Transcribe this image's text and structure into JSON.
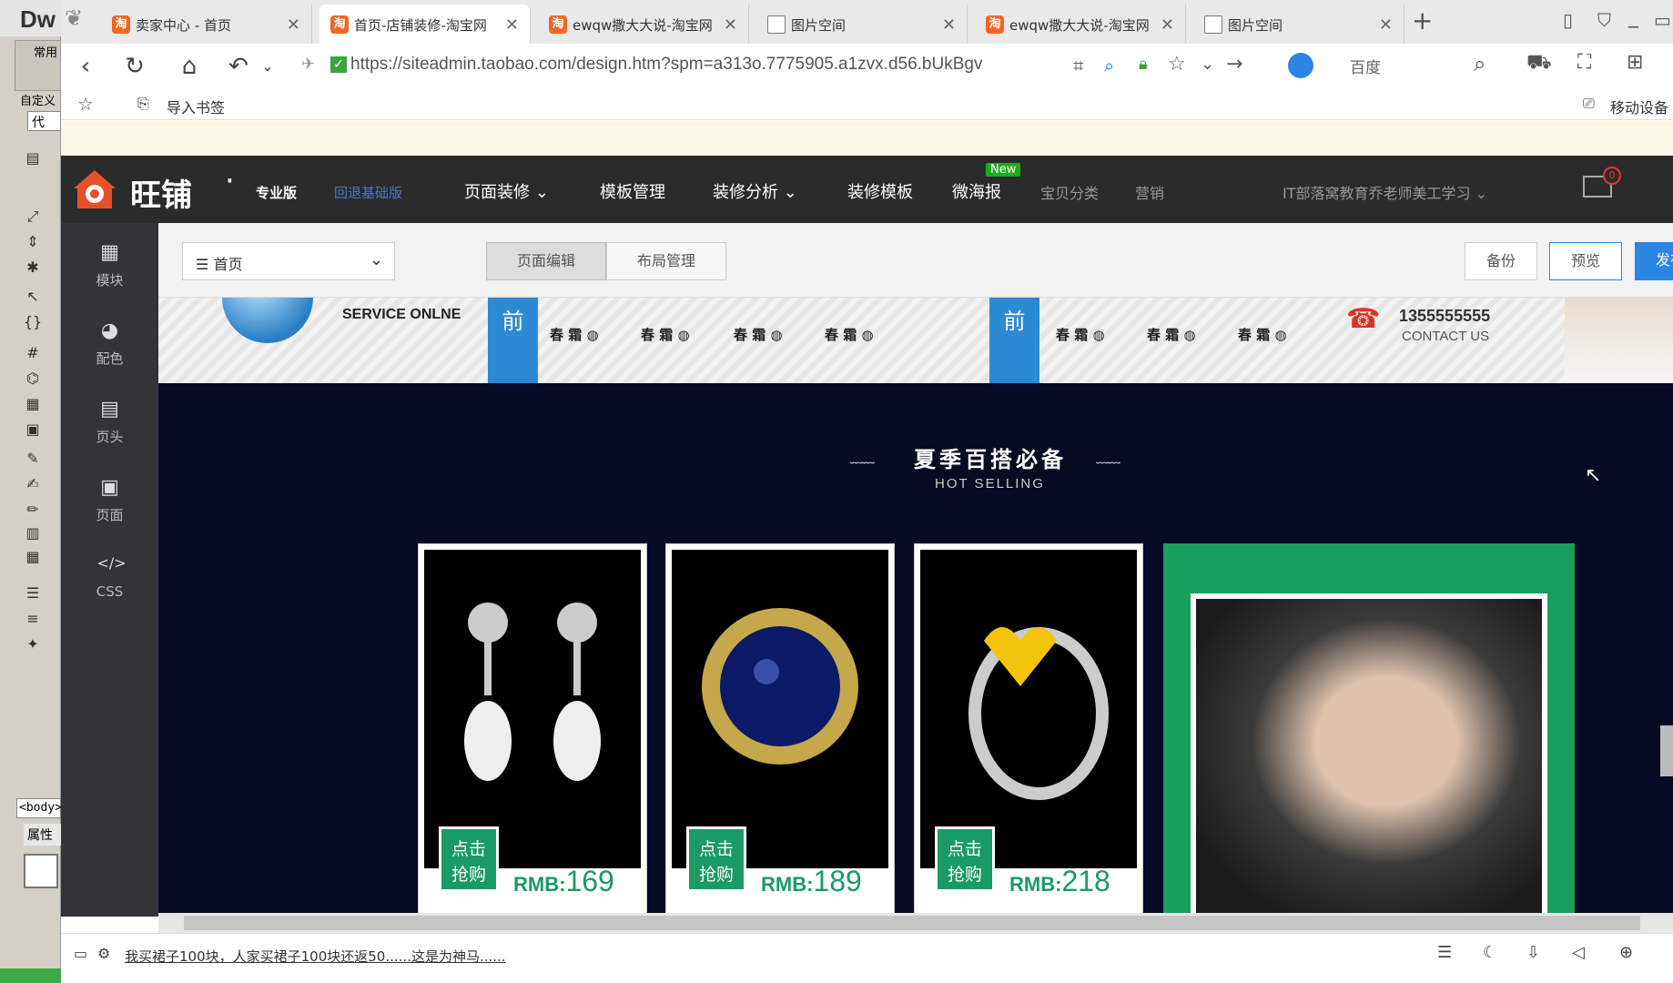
{
  "dreamweaver": {
    "logo": "Dw",
    "toolbar_labels": [
      "常用",
      "自定义",
      "代"
    ],
    "body_tag": "<body>",
    "properties_label": "属性"
  },
  "browser": {
    "tabs": [
      {
        "label": "卖家中心 - 首页",
        "icon": "taobao-icon",
        "active": false
      },
      {
        "label": "首页-店铺装修-淘宝网",
        "icon": "taobao-icon",
        "active": true
      },
      {
        "label": "ewqw撒大大说-淘宝网",
        "icon": "taobao-icon",
        "active": false
      },
      {
        "label": "图片空间",
        "icon": "doc-icon",
        "active": false
      },
      {
        "label": "ewqw撒大大说-淘宝网",
        "icon": "taobao-icon",
        "active": false
      },
      {
        "label": "图片空间",
        "icon": "doc-icon",
        "active": false
      }
    ],
    "url": "https://siteadmin.taobao.com/design.htm?spm=a313o.7775905.a1zvx.d56.bUkBgv",
    "search_engine": "百度",
    "bookmark_import": "导入书签",
    "mobile_bookmarks": "移动设备"
  },
  "wangpu": {
    "brand": "旺铺",
    "edition": "专业版",
    "back_basic": "回退基础版",
    "nav": [
      {
        "label": "页面装修",
        "dropdown": true
      },
      {
        "label": "模板管理",
        "dropdown": false
      },
      {
        "label": "装修分析",
        "dropdown": true
      },
      {
        "label": "装修模板",
        "dropdown": false
      },
      {
        "label": "微海报",
        "dropdown": false,
        "badge": "New"
      }
    ],
    "nav_secondary": [
      "宝贝分类",
      "营销"
    ],
    "account": "IT部落窝教育乔老师美工学习",
    "mail_count": "0",
    "sidebar": [
      {
        "label": "模块",
        "icon": "grid-icon"
      },
      {
        "label": "配色",
        "icon": "palette-icon"
      },
      {
        "label": "页头",
        "icon": "header-icon"
      },
      {
        "label": "页面",
        "icon": "page-icon"
      },
      {
        "label": "CSS",
        "icon": "code-icon"
      }
    ],
    "page_select": "首页",
    "tab_page_edit": "页面编辑",
    "tab_layout": "布局管理",
    "btn_backup": "备份",
    "btn_preview": "预览",
    "btn_publish": "发布站点"
  },
  "canvas": {
    "service_text": "SERVICE ONLNE",
    "service_tag": "前",
    "agents": [
      "春 霜",
      "春 霜",
      "春 霜",
      "春 霜",
      "春 霜",
      "春 霜",
      "春 霜"
    ],
    "phone": "1355555555",
    "contact": "CONTACT US",
    "section_title": "夏季百搭必备",
    "section_sub": "HOT SELLING",
    "products": [
      {
        "name": "pearl-earrings",
        "buy_label_1": "点击",
        "buy_label_2": "抢购",
        "currency": "RMB:",
        "price": "169"
      },
      {
        "name": "sapphire-ring",
        "buy_label_1": "点击",
        "buy_label_2": "抢购",
        "currency": "RMB:",
        "price": "189"
      },
      {
        "name": "heart-ring",
        "buy_label_1": "点击",
        "buy_label_2": "抢购",
        "currency": "RMB:",
        "price": "218"
      }
    ]
  },
  "status_bar": {
    "marquee": "我买裙子100块，人家买裙子100块还返50......这是为神马......"
  },
  "colors": {
    "taobao_orange": "#f26522",
    "publish_blue": "#2b85e4",
    "product_green": "#1a9a64",
    "canvas_bg": "#060a23",
    "header_dark": "#2b2b2b"
  }
}
